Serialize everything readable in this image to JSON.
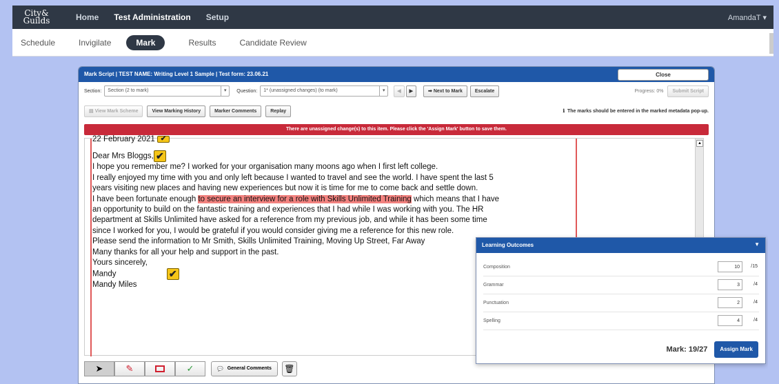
{
  "topnav": {
    "logo_line1": "City&",
    "logo_line2": "Guilds",
    "items": [
      "Home",
      "Test Administration",
      "Setup"
    ],
    "active": "Test Administration",
    "user": "AmandaT ▾"
  },
  "subnav": {
    "items": [
      "Schedule",
      "Invigilate",
      "Mark",
      "Results",
      "Candidate Review"
    ],
    "active": "Mark"
  },
  "modal": {
    "title": "Mark Script | TEST NAME: Writing Level 1 Sample | Test form: 23.06.21",
    "close_label": "Close",
    "section_label": "Section:",
    "section_value": "Section (2 to mark)",
    "question_label": "Question:",
    "question_value": "1* (unassigned changes) (to mark)",
    "next_to_mark": "Next to Mark",
    "escalate": "Escalate",
    "progress": "Progress: 0%",
    "submit_script": "Submit Script",
    "view_mark_scheme": "View Mark Scheme",
    "view_marking_history": "View Marking History",
    "marker_comments": "Marker Comments",
    "replay": "Replay",
    "info_text": "The marks should be entered in the marked metadata pop-up.",
    "error_text": "There are unassigned change(s) to this item. Please click the 'Assign Mark' button to save them."
  },
  "document": {
    "line0": "22 February 2021",
    "greeting": "Dear Mrs Bloggs,",
    "line1": "I hope you remember me? I worked for your organisation many moons ago when I first left college.",
    "line2": "I really enjoyed my time with you and only left because I wanted to travel and see the world. I have spent the last 5",
    "line3": "years visiting new places and having new experiences but now it is time for me to come back and settle down.",
    "line4_pre": "I have been fortunate enough ",
    "line4_hl": "to secure an interview for a role with Skills Unlimited Training",
    "line4_post": " which means that I have",
    "line5": "an opportunity to build on the fantastic training and experiences that I had while I was working with you. The HR",
    "line6": "department at Skills Unlimited have asked for a reference from my previous job, and while it has been some time",
    "line7": "since I worked for you, I would be grateful if you would consider giving me a reference for this new role.",
    "line8": "Please send the information to Mr Smith, Skills Unlimited Training, Moving Up Street, Far Away",
    "line9": "Many thanks for all your help and support in the past.",
    "line10": "Yours sincerely,",
    "line11": "Mandy",
    "line12": "Mandy Miles"
  },
  "tools": {
    "general_comments": "General Comments"
  },
  "learning_outcomes": {
    "title": "Learning Outcomes",
    "rows": [
      {
        "label": "Composition",
        "score": "10",
        "max": "/15"
      },
      {
        "label": "Grammar",
        "score": "3",
        "max": "/4"
      },
      {
        "label": "Punctuation",
        "score": "2",
        "max": "/4"
      },
      {
        "label": "Spelling",
        "score": "4",
        "max": "/4"
      }
    ],
    "mark_total": "Mark: 19/27",
    "assign_label": "Assign Mark"
  }
}
